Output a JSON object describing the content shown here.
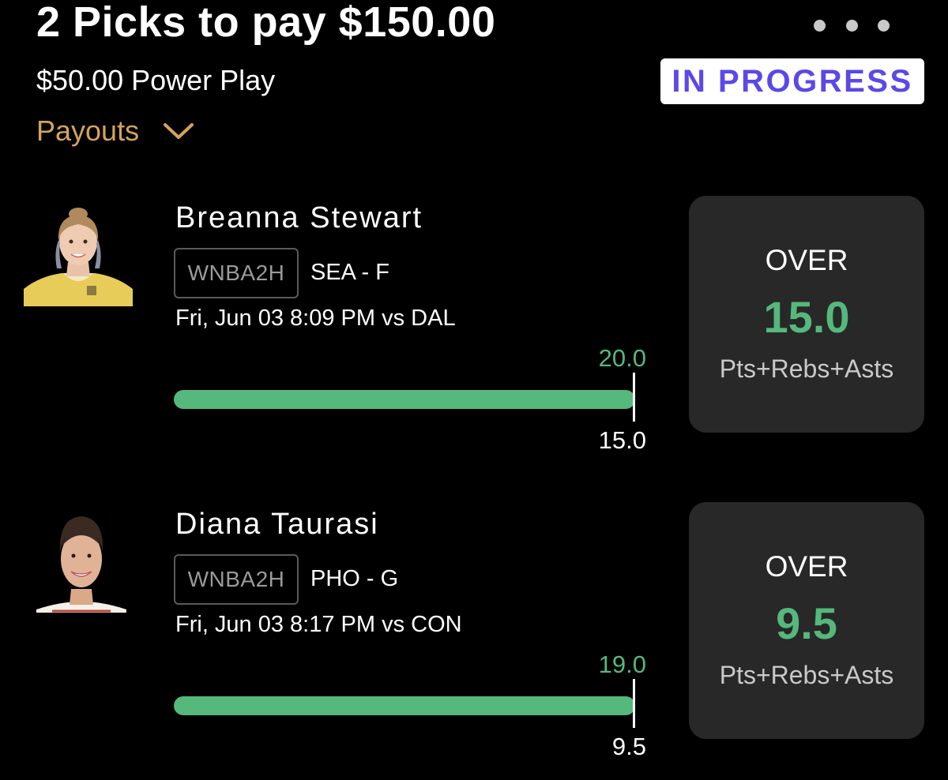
{
  "header": {
    "title": "2 Picks to pay $150.00",
    "entry": "$50.00 Power Play",
    "payouts_label": "Payouts",
    "status": "IN PROGRESS"
  },
  "colors": {
    "accent_green": "#55b87c",
    "payouts_gold": "#d4a35c",
    "status_purple": "#5b48e8",
    "card_bg": "#282828"
  },
  "picks": [
    {
      "player": "Breanna Stewart",
      "league": "WNBA2H",
      "team_pos": "SEA - F",
      "game": "Fri, Jun 03 8:09 PM  vs DAL",
      "actual": "20.0",
      "line": "15.0",
      "progress_fraction": 1.0,
      "direction": "OVER",
      "projection": "15.0",
      "stat": "Pts+Rebs+Asts"
    },
    {
      "player": "Diana Taurasi",
      "league": "WNBA2H",
      "team_pos": "PHO - G",
      "game": "Fri, Jun 03 8:17 PM  vs CON",
      "actual": "19.0",
      "line": "9.5",
      "progress_fraction": 1.0,
      "direction": "OVER",
      "projection": "9.5",
      "stat": "Pts+Rebs+Asts"
    }
  ]
}
